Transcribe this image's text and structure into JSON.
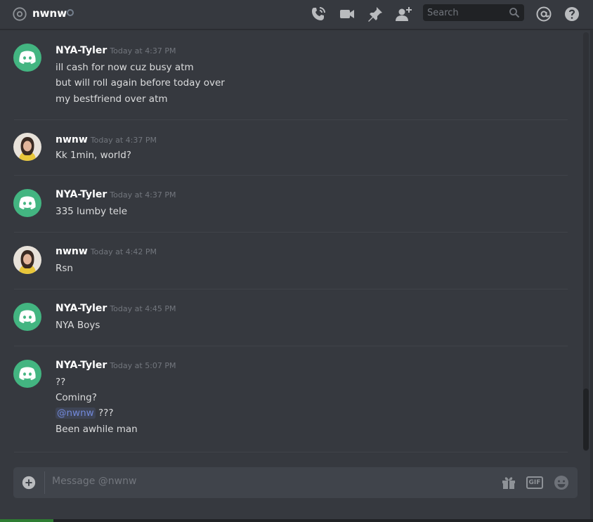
{
  "header": {
    "channel_name": "nwnw",
    "search_placeholder": "Search"
  },
  "messages": [
    {
      "author": "NYA-Tyler",
      "avatar": "discord-logo",
      "timestamp": "Today at 4:37 PM",
      "lines": [
        "ill cash for now cuz busy atm",
        "but will roll again before today over",
        "my bestfriend over atm"
      ]
    },
    {
      "author": "nwnw",
      "avatar": "user-photo",
      "timestamp": "Today at 4:37 PM",
      "lines": [
        "Kk 1min, world?"
      ]
    },
    {
      "author": "NYA-Tyler",
      "avatar": "discord-logo",
      "timestamp": "Today at 4:37 PM",
      "lines": [
        "335 lumby tele"
      ]
    },
    {
      "author": "nwnw",
      "avatar": "user-photo",
      "timestamp": "Today at 4:42 PM",
      "lines": [
        "Rsn"
      ]
    },
    {
      "author": "NYA-Tyler",
      "avatar": "discord-logo",
      "timestamp": "Today at 4:45 PM",
      "lines": [
        "NYA Boys"
      ]
    },
    {
      "author": "NYA-Tyler",
      "avatar": "discord-logo",
      "timestamp": "Today at 5:07 PM",
      "lines": [
        "??",
        "Coming?",
        "???",
        "Been awhile man"
      ],
      "mention": "@nwnw"
    }
  ],
  "composer": {
    "placeholder": "Message @nwnw",
    "gif_label": "GIF"
  },
  "colors": {
    "background": "#36393f",
    "bot_avatar": "#43b581",
    "mention": "#7289da"
  }
}
